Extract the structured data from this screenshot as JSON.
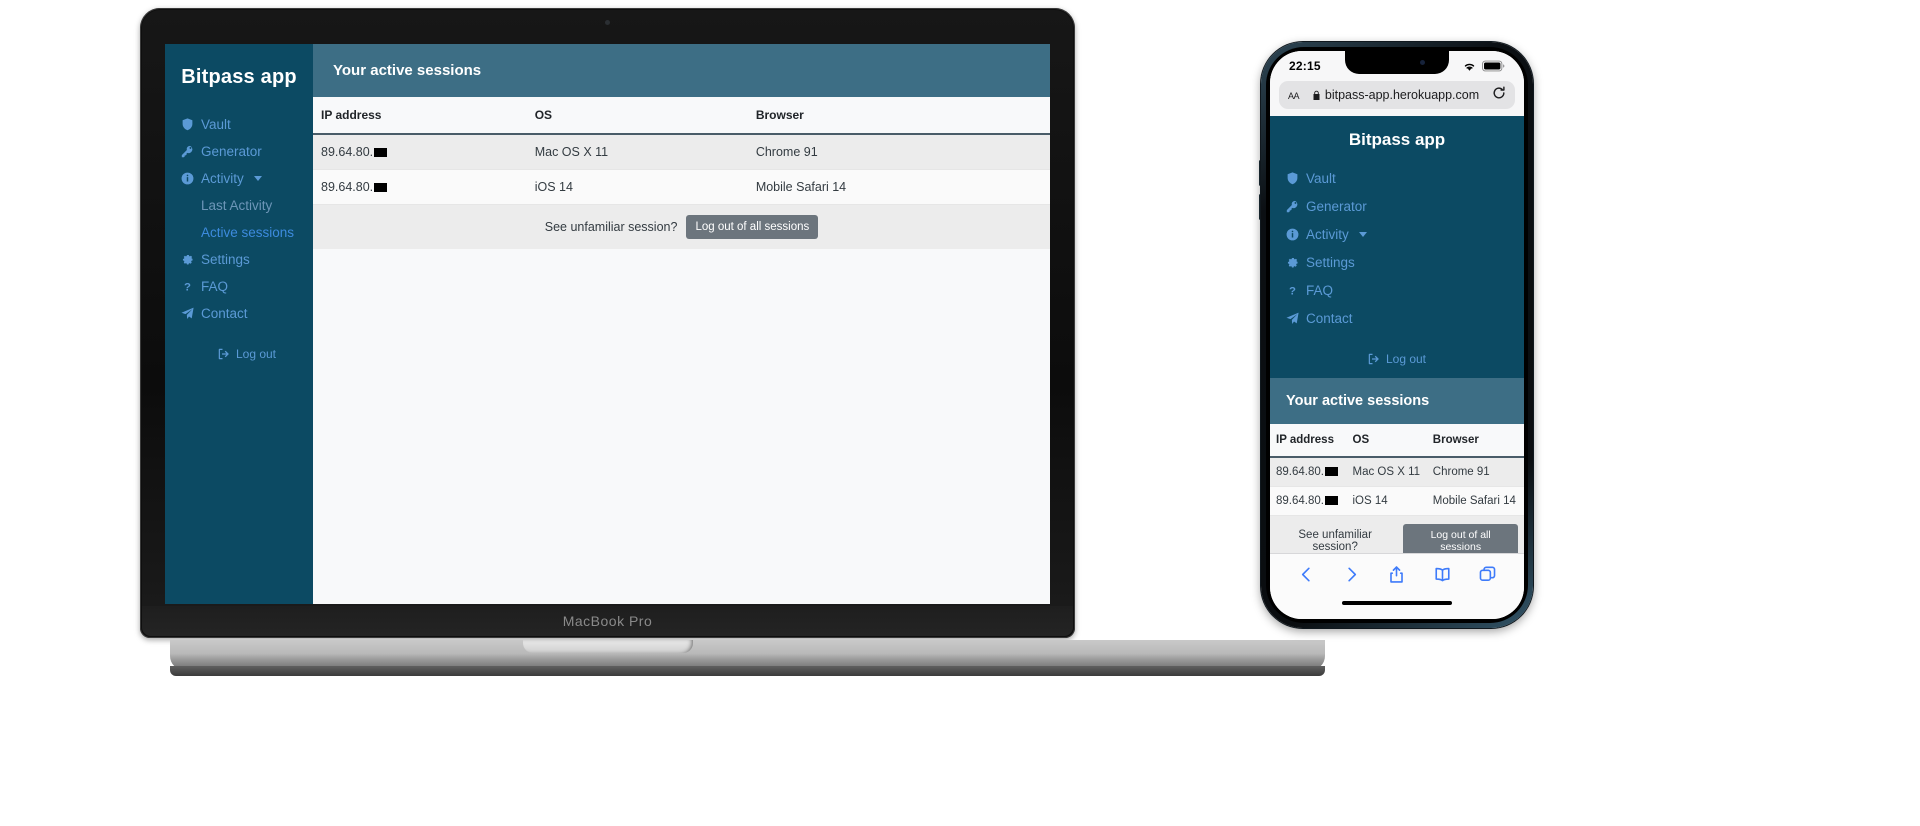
{
  "app": {
    "brand": "Bitpass app",
    "nav": [
      {
        "label": "Vault",
        "icon": "shield-icon"
      },
      {
        "label": "Generator",
        "icon": "key-icon"
      },
      {
        "label": "Activity",
        "icon": "info-circle-icon",
        "has_caret": true
      },
      {
        "label": "Settings",
        "icon": "gear-icon"
      },
      {
        "label": "FAQ",
        "icon": "question-icon"
      },
      {
        "label": "Contact",
        "icon": "paper-plane-icon"
      }
    ],
    "sub_nav": [
      {
        "label": "Last Activity",
        "active": false
      },
      {
        "label": "Active sessions",
        "active": true
      }
    ],
    "logout_label": "Log out",
    "page_title": "Your active sessions",
    "table": {
      "columns": [
        "IP address",
        "OS",
        "Browser"
      ],
      "rows": [
        {
          "ip": "89.64.80.",
          "ip_redacted": true,
          "os": "Mac OS X 11",
          "browser": "Chrome 91"
        },
        {
          "ip": "89.64.80.",
          "ip_redacted": true,
          "os": "iOS 14",
          "browser": "Mobile Safari 14"
        }
      ]
    },
    "footer": {
      "hint": "See unfamiliar session?",
      "button_label": "Log out of all sessions"
    }
  },
  "macbook": {
    "model_label": "MacBook Pro"
  },
  "iphone": {
    "status": {
      "time": "22:15",
      "wifi_icon": "wifi-icon",
      "battery_icon": "battery-icon"
    },
    "browser": {
      "text_size_label": "AA",
      "lock_icon": "lock-icon",
      "url": "bitpass-app.herokuapp.com",
      "reload_icon": "reload-icon",
      "toolbar": [
        {
          "name": "back-icon"
        },
        {
          "name": "forward-icon"
        },
        {
          "name": "share-icon"
        },
        {
          "name": "bookmarks-icon"
        },
        {
          "name": "tabs-icon"
        }
      ]
    }
  },
  "colors": {
    "sidebar": "#0c4a63",
    "header": "#3d6e85",
    "link": "#5b9ad6",
    "active_link": "#3d8bde",
    "button_gray": "#6c757d"
  }
}
